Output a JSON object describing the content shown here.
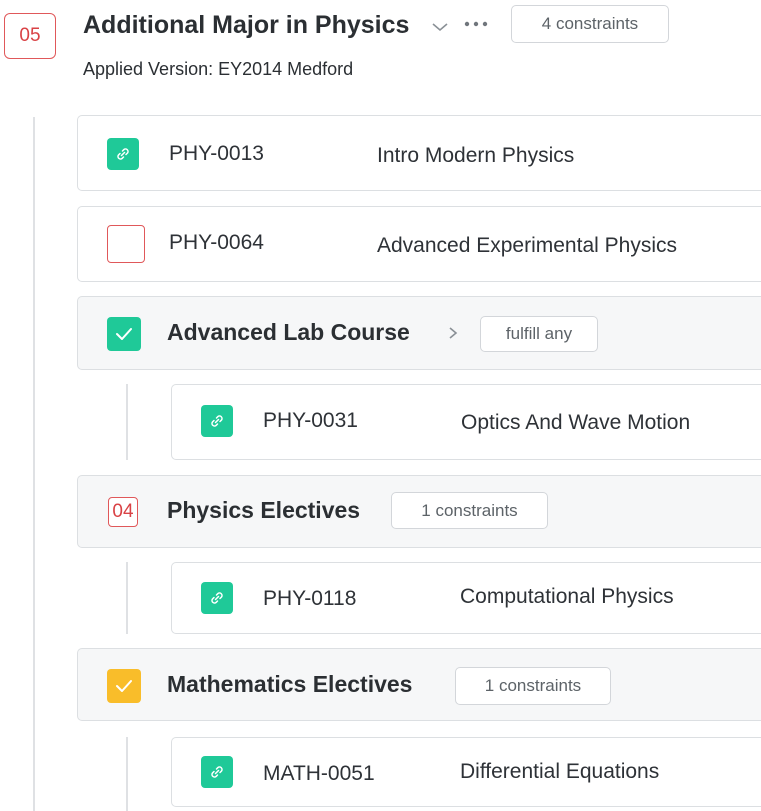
{
  "header": {
    "badge": "05",
    "title": "Additional Major in Physics",
    "constraints": "4 constraints",
    "subtitle": "Applied Version: EY2014 Medford"
  },
  "items": [
    {
      "code": "PHY-0013",
      "name": "Intro Modern Physics",
      "status": "linked"
    },
    {
      "code": "PHY-0064",
      "name": "Advanced Experimental Physics",
      "status": "unfulfilled"
    }
  ],
  "groups": [
    {
      "title": "Advanced Lab Course",
      "status": "complete",
      "tag": "fulfill any",
      "child": {
        "code": "PHY-0031",
        "name": "Optics And Wave Motion",
        "status": "linked"
      }
    },
    {
      "title": "Physics Electives",
      "status": "count",
      "badge": "04",
      "tag": "1 constraints",
      "child": {
        "code": "PHY-0118",
        "name": "Computational Physics",
        "status": "linked"
      }
    },
    {
      "title": "Mathematics Electives",
      "status": "partial",
      "tag": "1 constraints",
      "child": {
        "code": "MATH-0051",
        "name": "Differential Equations",
        "status": "linked"
      }
    }
  ],
  "colors": {
    "linked": "#1fc998",
    "partial": "#f9bd2a",
    "alert": "#e0585a"
  }
}
